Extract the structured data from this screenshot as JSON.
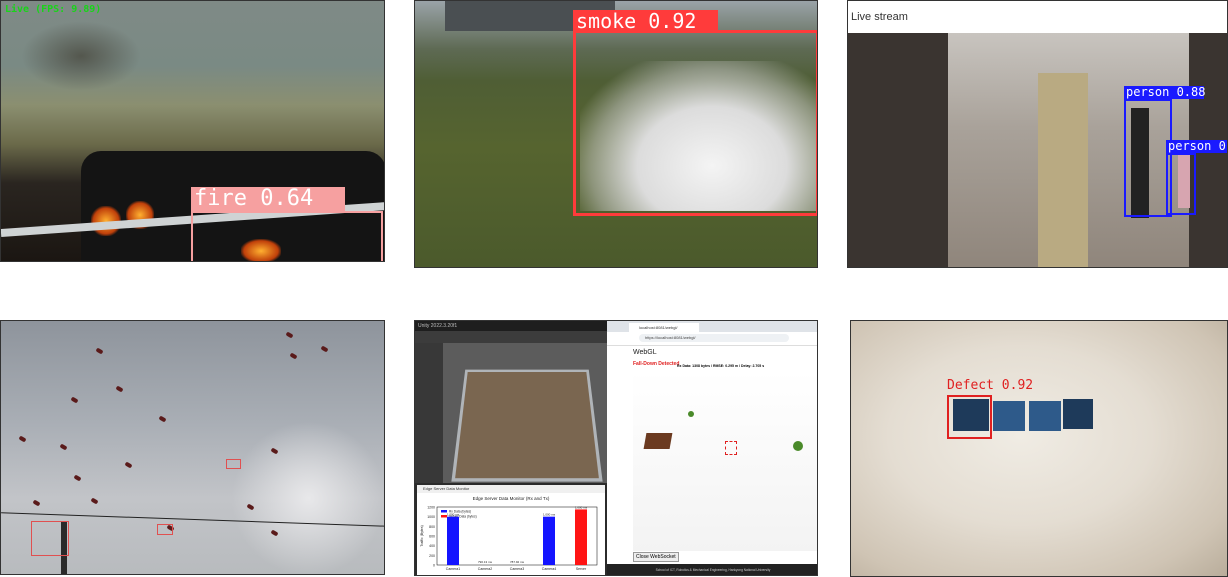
{
  "fire_panel": {
    "overlay": "Live (FPS: 9.89)",
    "label": "fire 0.64",
    "box_color": "#f6a0a0"
  },
  "smoke_panel": {
    "label": "smoke 0.92",
    "box_color": "#ff3b3b"
  },
  "person_panel": {
    "header": "Live stream",
    "labels": [
      "person 0.88",
      "person 0."
    ],
    "box_color": "#1a1aff"
  },
  "birds_panel": {
    "box_color": "#e05050"
  },
  "sim_panel": {
    "unity_title": "Unity 2022.3.20f1",
    "webgl_tab": "localhost:8081/webgl/",
    "webgl_url": "https://localhost:8081/webgl/",
    "webgl_heading": "WebGL",
    "fall_alert": "Fall-Down Detected",
    "stats": "Rx Data: 1308 bytes / RMSE: 0.295 m / Delay: 2.705 s",
    "close_button": "Close WebSocket",
    "footer_line1": "School of ICT, Robotics & Mechanical Engineering, Hankyong National University",
    "monitor_title": "Edge Server Data Monitor",
    "chart_title": "Edge Server Data Monitor (Rx and Tx)",
    "legend": [
      "Rx Data (bytes)",
      "Server Data (bytes)"
    ],
    "ylabel": "Traffic (Bytes)",
    "categories": [
      "Camera1",
      "Camera2",
      "Camera3",
      "Camera4",
      "Server"
    ],
    "bar_labels": [
      "1,000 ms",
      "790.13 ms",
      "787.92 ms",
      "1,000 ms",
      "1,000 ms"
    ],
    "chart_data": {
      "type": "bar",
      "categories": [
        "Camera1",
        "Camera2",
        "Camera3",
        "Camera4",
        "Server"
      ],
      "series": [
        {
          "name": "Rx Data (bytes)",
          "values": [
            1000,
            0,
            0,
            1000,
            0
          ]
        },
        {
          "name": "Server Data (bytes)",
          "values": [
            0,
            0,
            0,
            0,
            1150
          ]
        }
      ],
      "ylim": [
        0,
        1200
      ],
      "yticks": [
        0,
        200,
        400,
        600,
        800,
        1000,
        1200
      ],
      "colors": [
        "#1414ff",
        "#ff1414"
      ]
    }
  },
  "defect_panel": {
    "label": "Defect 0.92",
    "box_color": "#e02020"
  }
}
